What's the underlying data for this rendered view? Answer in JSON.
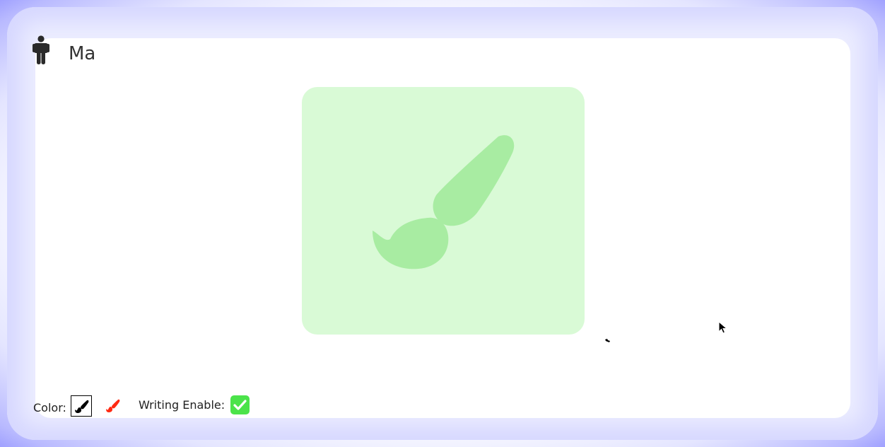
{
  "user": {
    "name": "Ma",
    "icon": "person-icon"
  },
  "canvas": {
    "placeholder_icon": "paint-brush-icon",
    "background": "#d9fad6",
    "icon_color": "#a8eca2"
  },
  "toolbar": {
    "color_label": "Color:",
    "colors": [
      {
        "name": "black",
        "value": "#000000",
        "selected": true,
        "icon": "paint-brush-icon"
      },
      {
        "name": "red",
        "value": "#ff2a12",
        "selected": false,
        "icon": "paint-brush-icon"
      }
    ],
    "writing_enable_label": "Writing Enable:",
    "writing_enabled": true,
    "checkbox_color": "#4be34a"
  }
}
